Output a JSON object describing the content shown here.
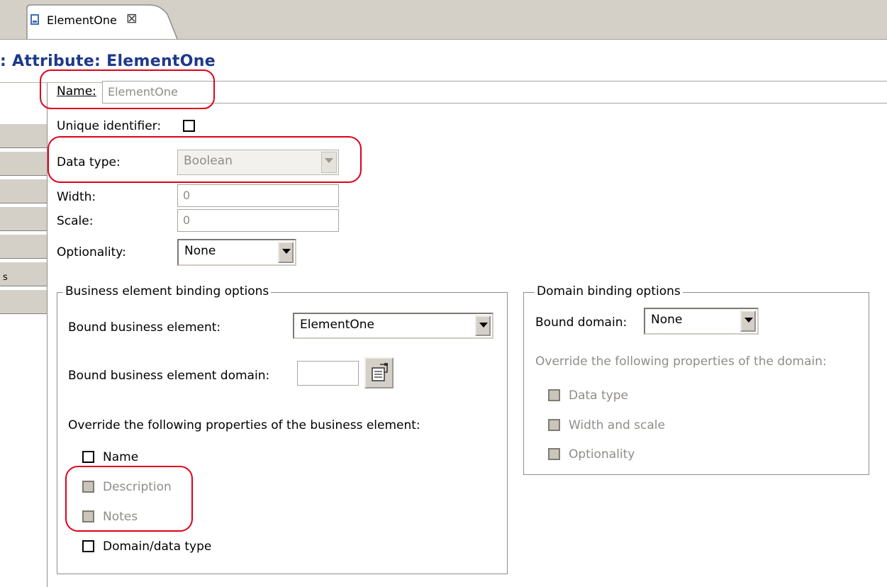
{
  "tab": {
    "label": "ElementOne",
    "close_glyph": "⊠"
  },
  "page": {
    "title": ": Attribute: ElementOne"
  },
  "left_panel": {
    "partial_label": "s"
  },
  "form": {
    "name_label": "Name:",
    "name_value": "ElementOne",
    "unique_identifier_label": "Unique identifier:",
    "unique_identifier_checked": false,
    "data_type_label": "Data type:",
    "data_type_value": "Boolean",
    "width_label": "Width:",
    "width_value": "0",
    "scale_label": "Scale:",
    "scale_value": "0",
    "optionality_label": "Optionality:",
    "optionality_value": "None"
  },
  "business_group": {
    "title": "Business element binding options",
    "bound_element_label": "Bound business element:",
    "bound_element_value": "ElementOne",
    "bound_domain_label": "Bound business element domain:",
    "bound_domain_value": "",
    "override_label": "Override the following properties of the business element:",
    "overrides": [
      {
        "label": "Name",
        "checked": false,
        "enabled": true
      },
      {
        "label": "Description",
        "checked": false,
        "enabled": false
      },
      {
        "label": "Notes",
        "checked": false,
        "enabled": false
      },
      {
        "label": "Domain/data type",
        "checked": false,
        "enabled": true
      }
    ]
  },
  "domain_group": {
    "title": "Domain binding options",
    "bound_domain_label": "Bound domain:",
    "bound_domain_value": "None",
    "override_label": "Override the following properties of the domain:",
    "overrides": [
      {
        "label": "Data type",
        "checked": false,
        "enabled": false
      },
      {
        "label": "Width and scale",
        "checked": false,
        "enabled": false
      },
      {
        "label": "Optionality",
        "checked": false,
        "enabled": false
      }
    ]
  },
  "colors": {
    "title": "#1d3a8a",
    "chrome": "#d4d0c8",
    "disabled_text": "#8f8d88",
    "highlight": "#e0001b"
  },
  "icons": {
    "tab": "document-icon",
    "close": "close-icon",
    "picker": "domain-picker-icon",
    "dropdown": "chevron-down-icon"
  }
}
